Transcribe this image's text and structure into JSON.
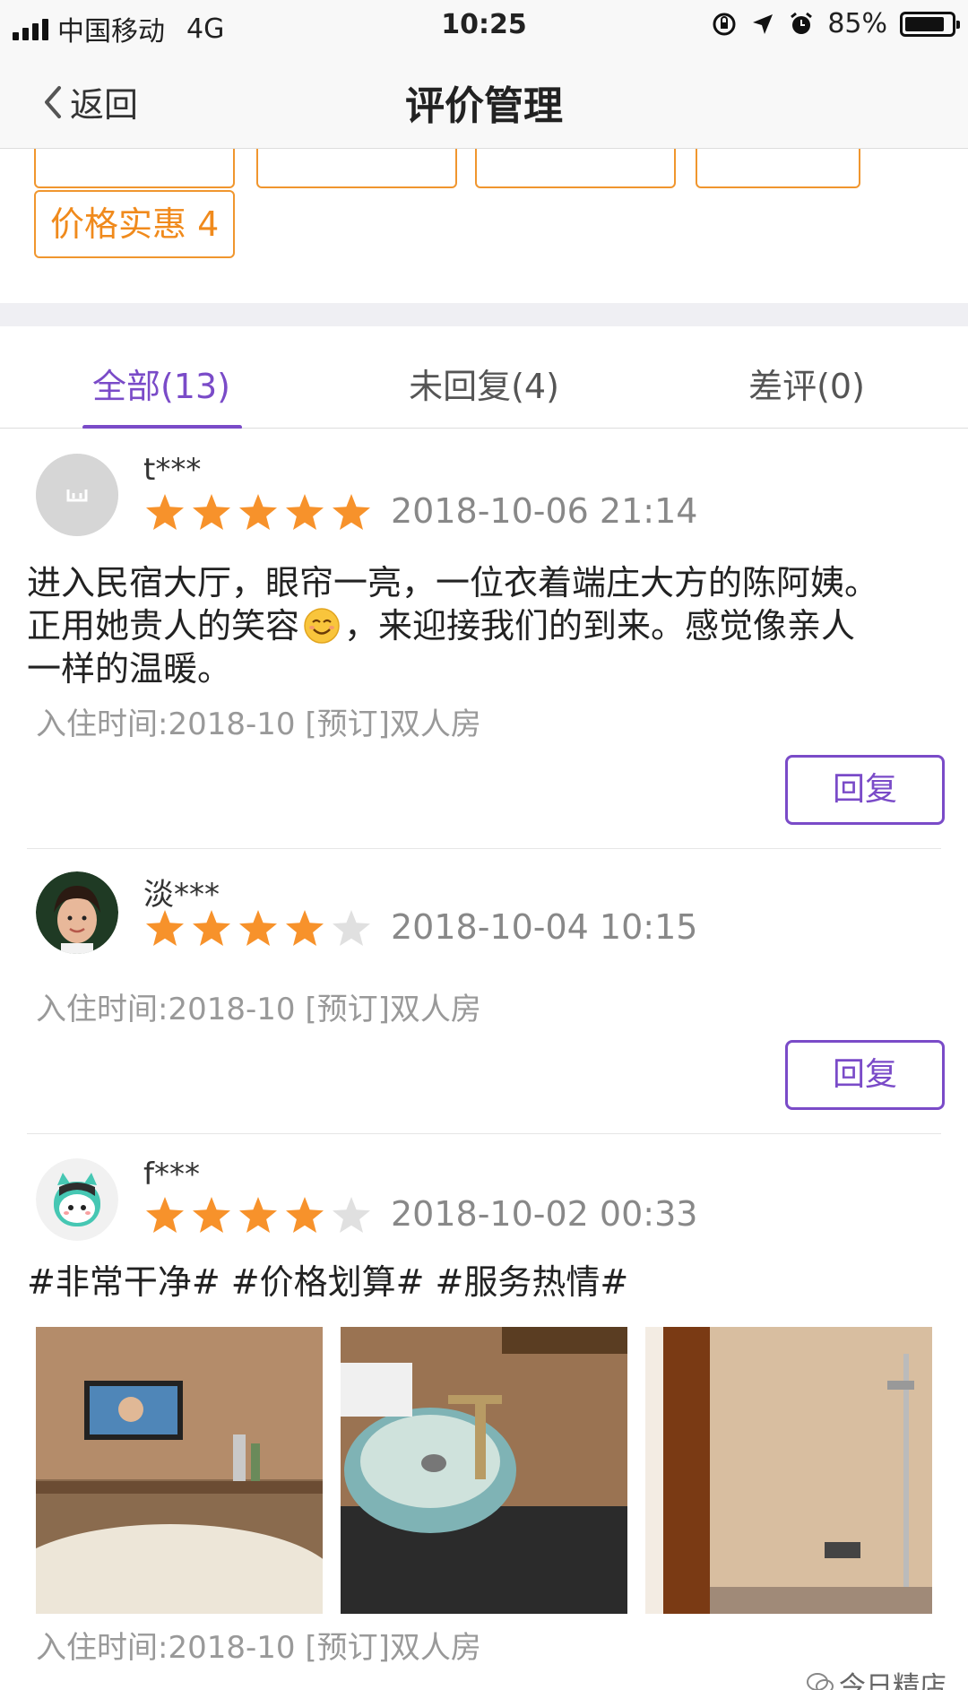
{
  "status_bar": {
    "carrier": "中国移动",
    "network": "4G",
    "time": "10:25",
    "battery": "85%",
    "battery_level": 0.85
  },
  "nav": {
    "back_label": "返回",
    "title": "评价管理"
  },
  "tags": {
    "price_tag": "价格实惠 4"
  },
  "tabs": [
    {
      "label": "全部(13)",
      "active": true
    },
    {
      "label": "未回复(4)",
      "active": false
    },
    {
      "label": "差评(0)",
      "active": false
    }
  ],
  "reviews": [
    {
      "user": "t***",
      "rating": 5,
      "date": "2018-10-06 21:14",
      "text_line1": "进入民宿大厅，眼帘一亮，一位衣着端庄大方的陈阿姨。",
      "text_line2a": "正用她贵人的笑容",
      "text_line2b": "，来迎接我们的到来。感觉像亲人",
      "text_line3": "一样的温暖。",
      "checkin": "入住时间:2018-10 [预订]双人房",
      "reply_label": "回复"
    },
    {
      "user": "淡***",
      "rating": 4,
      "date": "2018-10-04 10:15",
      "checkin": "入住时间:2018-10 [预订]双人房",
      "reply_label": "回复"
    },
    {
      "user": "f***",
      "rating": 4,
      "date": "2018-10-02 00:33",
      "text": "#非常干净# #价格划算# #服务热情#",
      "checkin": "入住时间:2018-10 [预订]双人房"
    }
  ],
  "watermark": "今日精店",
  "colors": {
    "accent": "#7a4bc8",
    "tag": "#f0962e",
    "star": "#f7922b",
    "star_empty": "#e0e0e0"
  }
}
